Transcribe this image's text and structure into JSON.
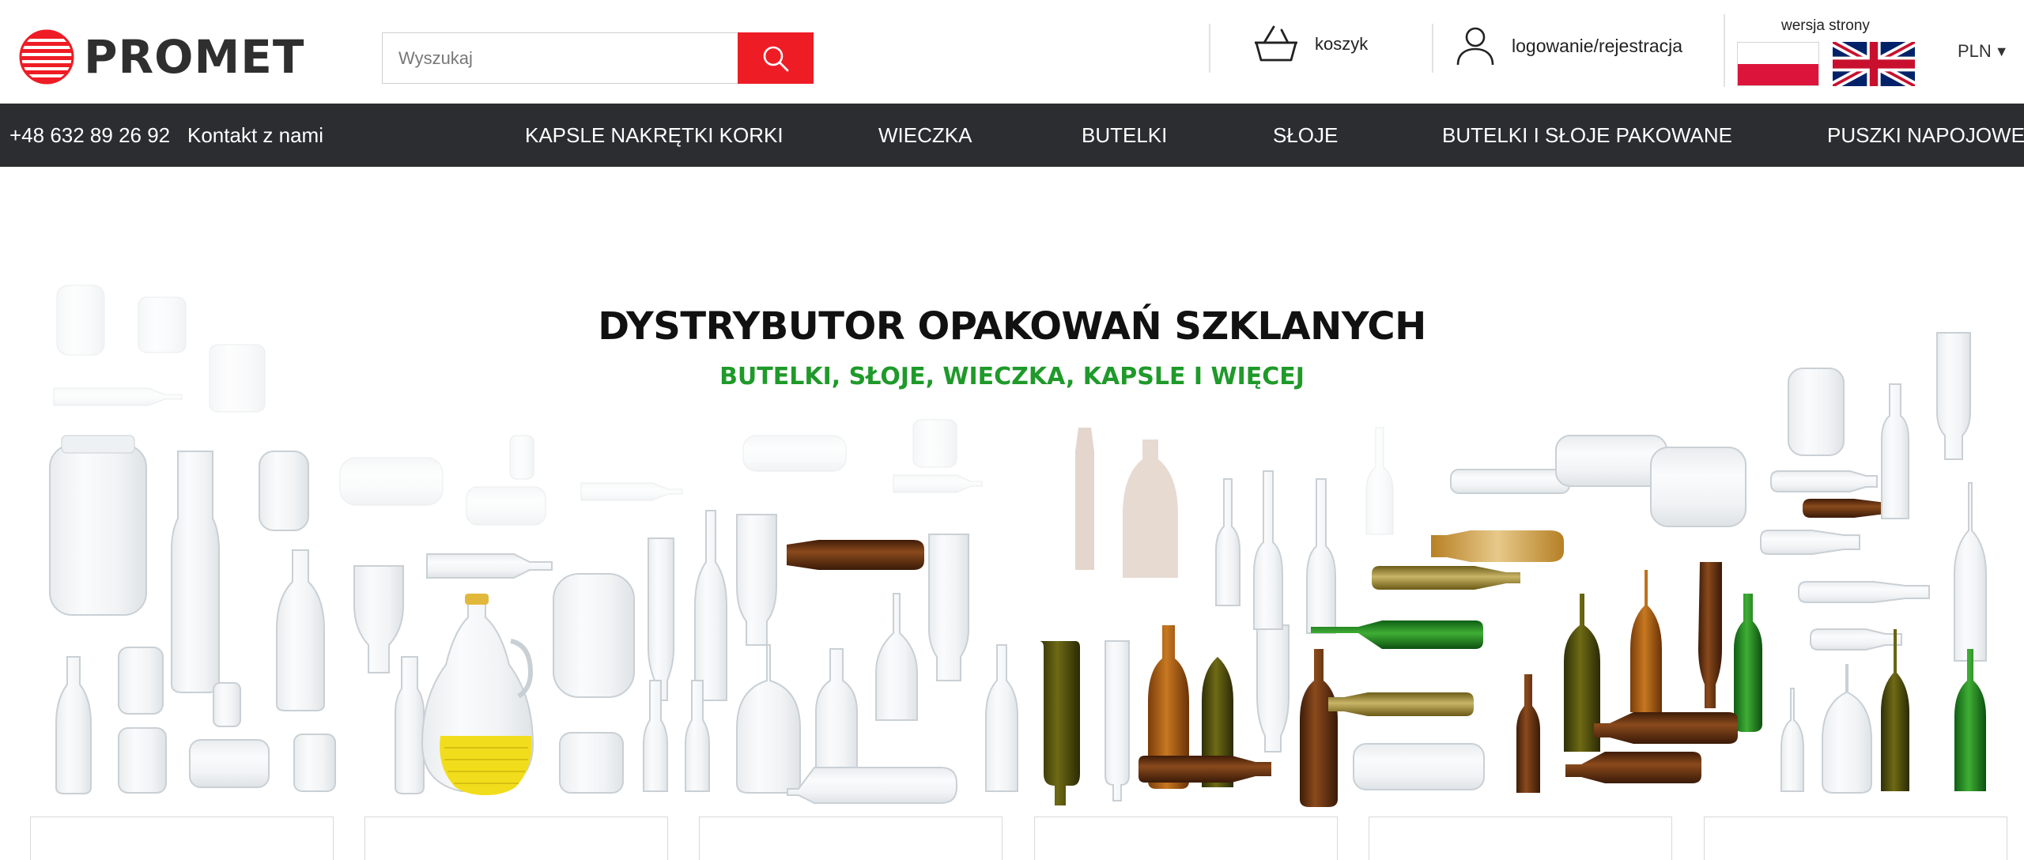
{
  "brand": {
    "name": "PROMET",
    "accent": "#ee1c25"
  },
  "search": {
    "placeholder": "Wyszukaj",
    "button_icon": "search-icon"
  },
  "header": {
    "cart_label": "koszyk",
    "account_label": "logowanie/rejestracja",
    "version_label": "wersja strony",
    "currency": "PLN",
    "currency_caret": "▼"
  },
  "nav": {
    "phone": "+48 632 89 26 92",
    "contact": "Kontakt z nami",
    "items": [
      {
        "label": "KAPSLE NAKRĘTKI KORKI"
      },
      {
        "label": "WIECZKA"
      },
      {
        "label": "BUTELKI"
      },
      {
        "label": "SŁOJE"
      },
      {
        "label": "BUTELKI I SŁOJE PAKOWANE"
      },
      {
        "label": "PUSZKI NAPOJOWE"
      }
    ]
  },
  "hero": {
    "title": "DYSTRYBUTOR OPAKOWAŃ SZKLANYCH",
    "subtitle": "BUTELKI, SŁOJE, WIECZKA, KAPSLE I WIĘCEJ",
    "title_color": "#111111",
    "subtitle_color": "#1f9a2a"
  },
  "colors": {
    "navbar": "#2b2d30",
    "nav_text": "#ffffff"
  }
}
